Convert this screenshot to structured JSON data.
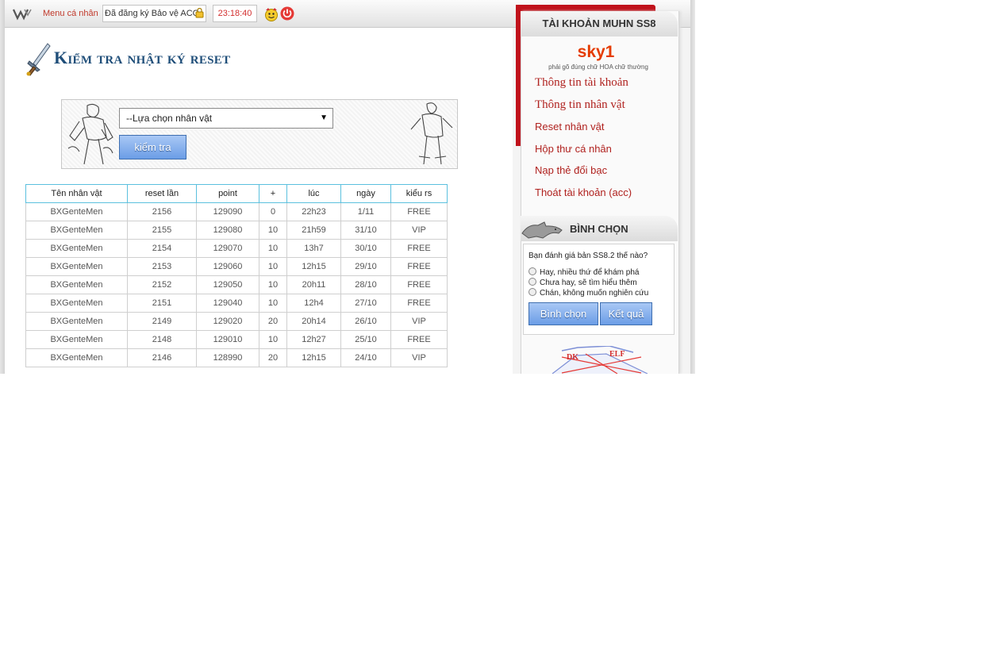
{
  "topbar": {
    "menu_label": "Menu cá nhân",
    "account_status": "Đã đăng ký Bảo vệ ACC",
    "clock": "23:18:40"
  },
  "main": {
    "title": "Kiểm tra nhật ký reset",
    "select_value": "--Lựa chọn nhân vật",
    "check_button": "kiểm tra"
  },
  "table": {
    "headers": [
      "Tên nhân vật",
      "reset lần",
      "point",
      "+",
      "lúc",
      "ngày",
      "kiểu rs"
    ],
    "rows": [
      [
        "BXGenteMen",
        "2156",
        "129090",
        "0",
        "22h23",
        "1/11",
        "FREE"
      ],
      [
        "BXGenteMen",
        "2155",
        "129080",
        "10",
        "21h59",
        "31/10",
        "VIP"
      ],
      [
        "BXGenteMen",
        "2154",
        "129070",
        "10",
        "13h7",
        "30/10",
        "FREE"
      ],
      [
        "BXGenteMen",
        "2153",
        "129060",
        "10",
        "12h15",
        "29/10",
        "FREE"
      ],
      [
        "BXGenteMen",
        "2152",
        "129050",
        "10",
        "20h11",
        "28/10",
        "FREE"
      ],
      [
        "BXGenteMen",
        "2151",
        "129040",
        "10",
        "12h4",
        "27/10",
        "FREE"
      ],
      [
        "BXGenteMen",
        "2149",
        "129020",
        "20",
        "20h14",
        "26/10",
        "VIP"
      ],
      [
        "BXGenteMen",
        "2148",
        "129010",
        "10",
        "12h27",
        "25/10",
        "FREE"
      ],
      [
        "BXGenteMen",
        "2146",
        "128990",
        "20",
        "12h15",
        "24/10",
        "VIP"
      ]
    ]
  },
  "sidebar": {
    "header": "TÀI KHOẢN MUHN SS8",
    "username": "sky1",
    "hint": "phải gõ đúng chữ HOA chữ thường",
    "links": [
      "Thông tin tài khoản",
      "Thông tin nhân vật",
      "Reset nhân vật",
      "Hộp thư cá nhân",
      "Nạp thẻ đổi bạc",
      "Thoát tài khoản (acc)"
    ]
  },
  "poll": {
    "title": "BÌNH CHỌN",
    "question": "Bạn đánh giá bản SS8.2 thế nào?",
    "options": [
      "Hay, nhiều thứ để khám phá",
      "Chưa hay, sẽ tìm hiểu thêm",
      "Chán, không muốn nghiên cứu"
    ],
    "vote_button": "Bình chọn",
    "result_button": "Kết quả"
  },
  "diagram": {
    "labels": [
      "DK",
      "ELF"
    ]
  },
  "colors": {
    "accent_red": "#c0121b",
    "link_red": "#b0221f",
    "title_blue": "#1f4e79",
    "button_blue": "#6b9de6",
    "username_orange": "#e53b00"
  },
  "icons": [
    "w-logo-icon",
    "lock-icon",
    "smiley-icon",
    "power-icon",
    "sword-icon",
    "wolf-icon"
  ]
}
